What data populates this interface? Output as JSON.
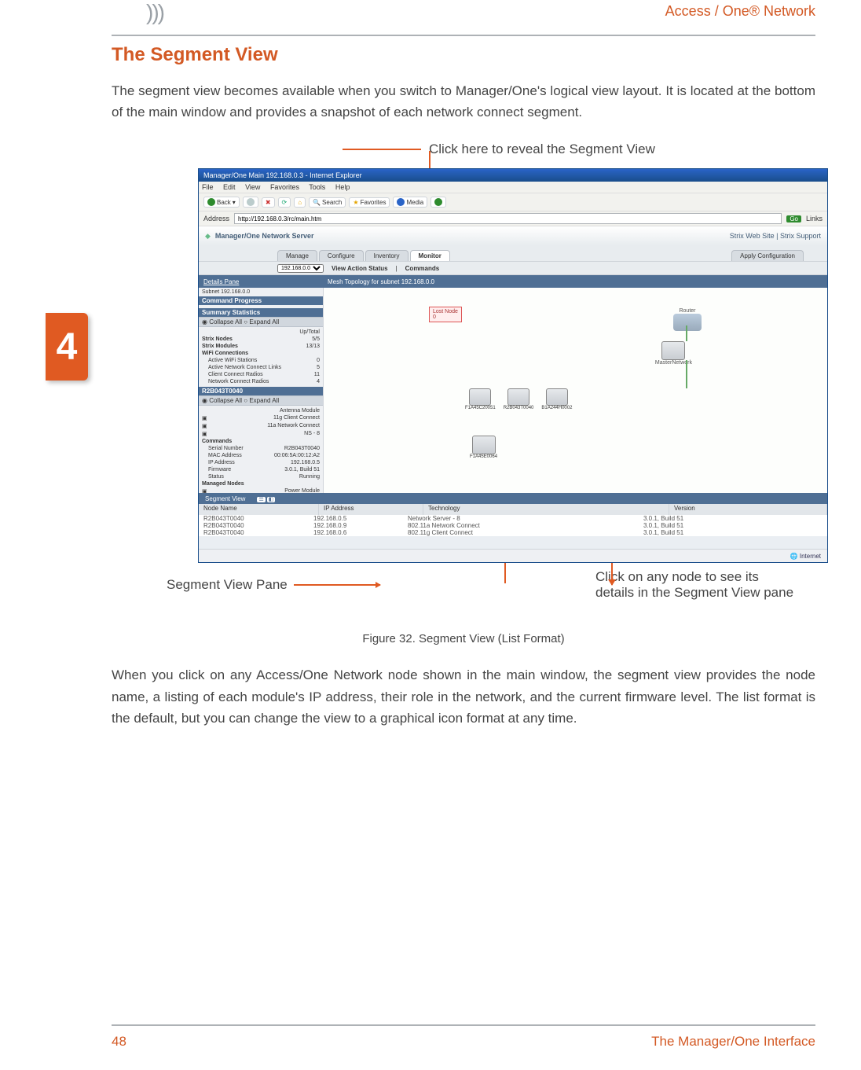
{
  "header": {
    "product": "Access / One® Network"
  },
  "chapter_tab": "4",
  "title": "The Segment View",
  "body": {
    "p1": "The segment view becomes available when you switch to Manager/One's logical view layout. It is located at the bottom of the main window and provides a snapshot of each network connect segment.",
    "p2": "When you click on any Access/One Network node shown in the main window, the segment view provides the node name, a listing of each module's IP address, their role in the network, and the current firmware level. The list format is the default, but you can change the view to a graphical icon format at any time."
  },
  "callouts": {
    "top": "Click here to reveal the Segment View",
    "left": "Segment View Pane",
    "right": "Click on any node to see its details in the Segment View pane"
  },
  "figure_caption": "Figure 32. Segment View (List Format)",
  "footer": {
    "page": "48",
    "title": "The Manager/One Interface"
  },
  "screenshot": {
    "window_title": "Manager/One Main 192.168.0.3 - Internet Explorer",
    "menus": [
      "File",
      "Edit",
      "View",
      "Favorites",
      "Tools",
      "Help"
    ],
    "toolbar": {
      "back": "Back",
      "search": "Search",
      "favorites": "Favorites",
      "media": "Media"
    },
    "address_label": "Address",
    "address_value": "http://192.168.0.3/rc/main.htm",
    "go": "Go",
    "links": "Links",
    "app_brand": "Manager/One Network Server",
    "app_links": "Strix Web Site  |  Strix Support",
    "tabs": {
      "manage": "Manage",
      "configure": "Configure",
      "inventory": "Inventory",
      "monitor": "Monitor",
      "apply": "Apply Configuration"
    },
    "subbar": {
      "ip": "192.168.0.0",
      "view_action": "View Action Status",
      "commands": "Commands"
    },
    "details_pane": "Details Pane",
    "subnet": "Subnet 192.168.0.0",
    "mesh_title": "Mesh Topology for subnet 192.168.0.0",
    "command_progress": "Command Progress",
    "summary": "Summary Statistics",
    "collapse": "Collapse All",
    "expand": "Expand All",
    "uptotal": "Up/Total",
    "stats": {
      "strix_nodes": {
        "label": "Strix Nodes",
        "val": "5/5"
      },
      "strix_modules": {
        "label": "Strix Modules",
        "val": "13/13"
      },
      "wifi": "WiFi Connections",
      "active_wifi": {
        "label": "Active WiFi Stations",
        "val": "0"
      },
      "active_net": {
        "label": "Active Network Connect Links",
        "val": "5"
      },
      "client_radios": {
        "label": "Client Connect Radios",
        "val": "11"
      },
      "net_radios": {
        "label": "Network Connect Radios",
        "val": "4"
      }
    },
    "node_header": "R2B043T0040",
    "module": {
      "antenna": "Antenna Module",
      "g": "11g Client Connect",
      "a": "11a Network Connect",
      "ns": "NS - 8"
    },
    "commands_label": "Commands",
    "detail_rows": {
      "serial": {
        "k": "Serial Number",
        "v": "R2B043T0040"
      },
      "mac": {
        "k": "MAC Address",
        "v": "00:06:5A:00:12:A2"
      },
      "ip": {
        "k": "IP Address",
        "v": "192.168.0.5"
      },
      "fw": {
        "k": "Firmware",
        "v": "3.0.1, Build 51"
      },
      "status": {
        "k": "Status",
        "v": "Running"
      }
    },
    "managed": "Managed Nodes",
    "power": "Power Module",
    "topo": {
      "lost": "Lost Node",
      "router": "Router",
      "master": "MasterNetwork",
      "n1": "F1A45C20051",
      "n2": "R2B043T0040",
      "n3": "B1A244H0002",
      "n4": "F1A45E0064"
    },
    "segment_bar": "Segment View",
    "seg_cols": {
      "c1": "Node Name",
      "c2": "IP Address",
      "c3": "Technology",
      "c4": "Version"
    },
    "seg_rows": [
      {
        "n": "R2B043T0040",
        "ip": "192.168.0.5",
        "t": "Network Server - 8",
        "v": "3.0.1, Build 51"
      },
      {
        "n": "R2B043T0040",
        "ip": "192.168.0.9",
        "t": "802.11a Network Connect",
        "v": "3.0.1, Build 51"
      },
      {
        "n": "R2B043T0040",
        "ip": "192.168.0.6",
        "t": "802.11g Client Connect",
        "v": "3.0.1, Build 51"
      }
    ],
    "status_text": "Internet"
  }
}
